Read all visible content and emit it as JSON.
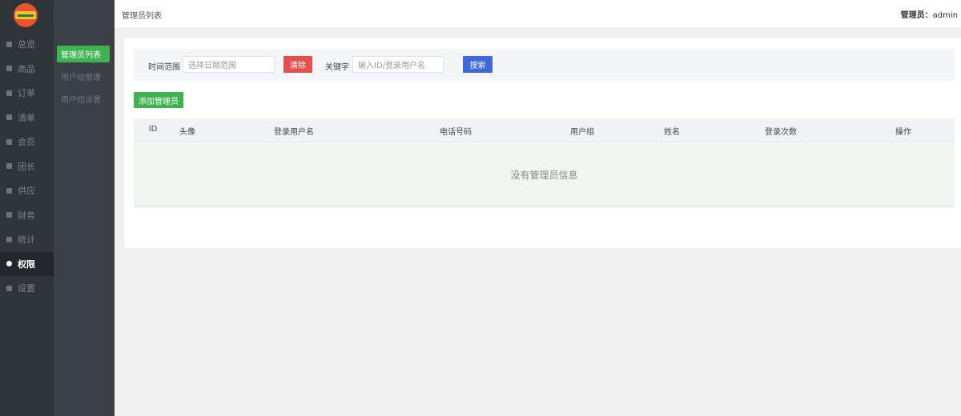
{
  "sidebar": {
    "items": [
      {
        "label": "总览",
        "icon": "grid-icon"
      },
      {
        "label": "商品",
        "icon": "box-icon"
      },
      {
        "label": "订单",
        "icon": "order-icon"
      },
      {
        "label": "清单",
        "icon": "list-icon"
      },
      {
        "label": "会员",
        "icon": "user-icon"
      },
      {
        "label": "团长",
        "icon": "leader-icon"
      },
      {
        "label": "供应",
        "icon": "supply-icon"
      },
      {
        "label": "财务",
        "icon": "money-icon"
      },
      {
        "label": "统计",
        "icon": "chart-icon"
      },
      {
        "label": "权限",
        "icon": "gear-icon",
        "active": true
      },
      {
        "label": "设置",
        "icon": "lock-icon"
      }
    ]
  },
  "subnav": {
    "items": [
      {
        "label": "管理员列表",
        "active": true
      },
      {
        "label": "用户组管理"
      },
      {
        "label": "用户组设置"
      }
    ]
  },
  "topbar": {
    "breadcrumb": "管理员列表",
    "user_label": "管理员：",
    "user_name": "admin"
  },
  "filter": {
    "time_label": "时间范围",
    "time_placeholder": "选择日期范围",
    "clear_label": "清除",
    "keyword_label": "关键字",
    "keyword_placeholder": "输入ID/登录用户名",
    "search_label": "搜索"
  },
  "actions": {
    "add_label": "添加管理员"
  },
  "table": {
    "columns": [
      "ID",
      "头像",
      "登录用户名",
      "电话号码",
      "用户组",
      "姓名",
      "登录次数",
      "操作"
    ],
    "empty_text": "没有管理员信息"
  },
  "colors": {
    "sidebar_bg": "#2f3439",
    "subnav_bg": "#3b4046",
    "accent_green": "#3fb34f",
    "clear_red": "#e3504b",
    "search_blue": "#3d68de"
  }
}
